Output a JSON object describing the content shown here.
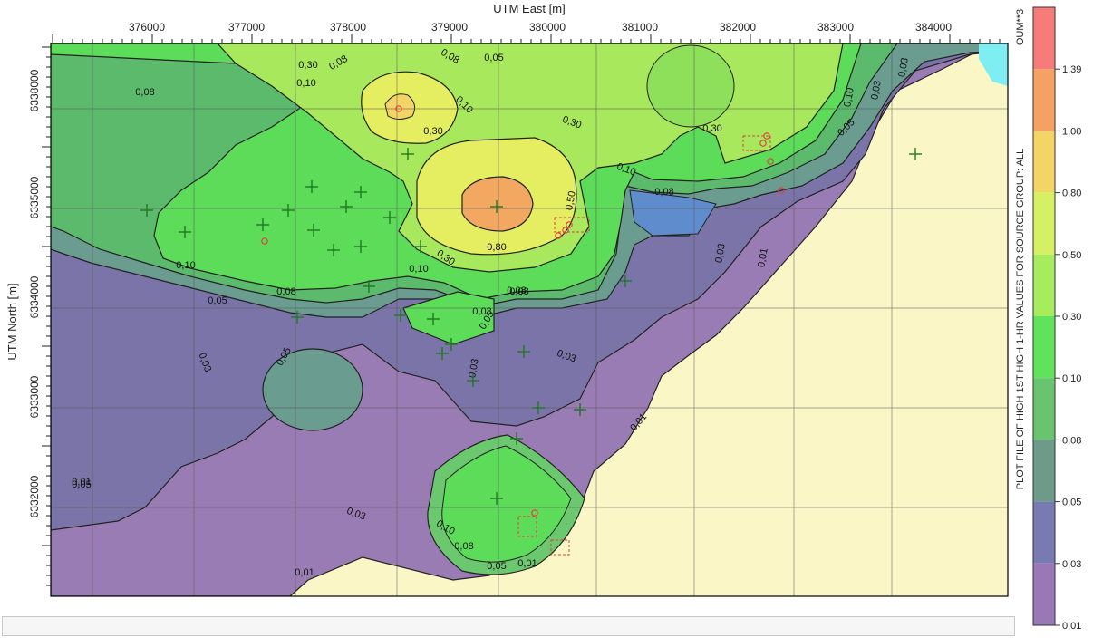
{
  "map": {
    "x_axis_title": "UTM East [m]",
    "y_axis_title": "UTM North [m]",
    "x_ticks": [
      "376000",
      "377000",
      "378000",
      "379000",
      "380000",
      "381000",
      "382000",
      "383000",
      "384000"
    ],
    "y_ticks": [
      "6338000",
      "6335000",
      "6334000",
      "6333000",
      "6332000"
    ]
  },
  "colorbar": {
    "title": "PLOT FILE OF HIGH 1ST HIGH 1-HR VALUES FOR SOURCE GROUP: ALL",
    "unit": "OUM**3",
    "labels": [
      "1,39",
      "1,00",
      "0,80",
      "0,50",
      "0,30",
      "0,10",
      "0,08",
      "0,05",
      "0,03",
      "0,01"
    ],
    "colors": [
      "#f77b79",
      "#f6a164",
      "#f3d565",
      "#d6f063",
      "#a6ec5c",
      "#5ee35a",
      "#68c46e",
      "#6e9a8a",
      "#7a7ab2",
      "#9a78b6"
    ]
  },
  "contour_labels": [
    "0,30",
    "0,10",
    "0,08",
    "0,08",
    "0,05",
    "0,08",
    "0,10",
    "0,30",
    "0,30",
    "0,50",
    "0,80",
    "0,30",
    "0,10",
    "0,10",
    "0,08",
    "0,05",
    "0,03",
    "0,05",
    "0,08",
    "0,03",
    "0,05",
    "0,03",
    "0,10",
    "0,08",
    "0,05",
    "0,01",
    "0,03",
    "0,03",
    "0,01",
    "0,01",
    "0,03",
    "0,01",
    "0,10",
    "0,05",
    "0,03",
    "0,10",
    "0,08",
    "0,30",
    "0,05",
    "0,08",
    "0,03",
    "0,01",
    "0,03"
  ],
  "legend_colors": {
    "plot_border": "#000000",
    "receptor": "#1e7a1e",
    "source": "#e04040"
  }
}
